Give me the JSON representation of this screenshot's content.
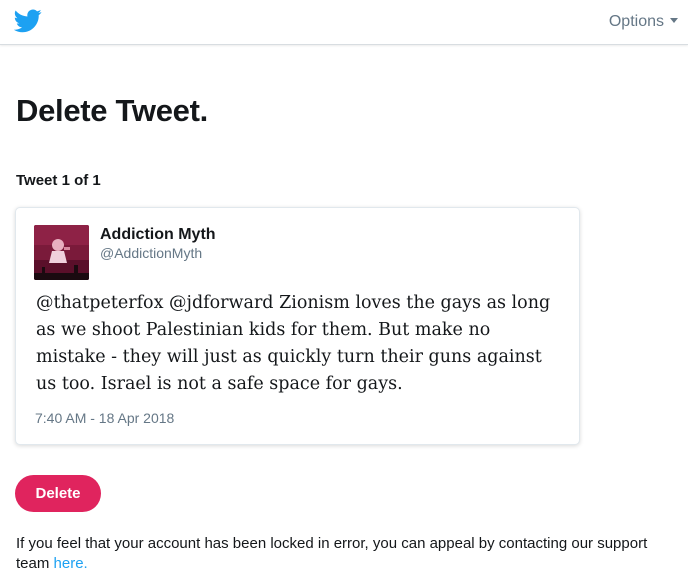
{
  "header": {
    "logo_icon": "twitter-bird-icon",
    "options_label": "Options",
    "accent_color": "#1da1f2"
  },
  "page": {
    "title": "Delete Tweet.",
    "counter": "Tweet 1 of 1"
  },
  "tweet": {
    "author_name": "Addiction Myth",
    "author_handle": "@AddictionMyth",
    "text": "@thatpeterfox @jdforward Zionism loves the gays as long as we shoot Palestinian kids for them. But make no mistake - they will just as quickly turn their guns against us too. Israel is not a safe space for gays.",
    "timestamp": "7:40 AM - 18 Apr 2018"
  },
  "actions": {
    "delete_label": "Delete",
    "delete_color": "#e0245e"
  },
  "footer": {
    "appeal_text": "If you feel that your account has been locked in error, you can appeal by contacting our support team ",
    "appeal_link": "here."
  }
}
